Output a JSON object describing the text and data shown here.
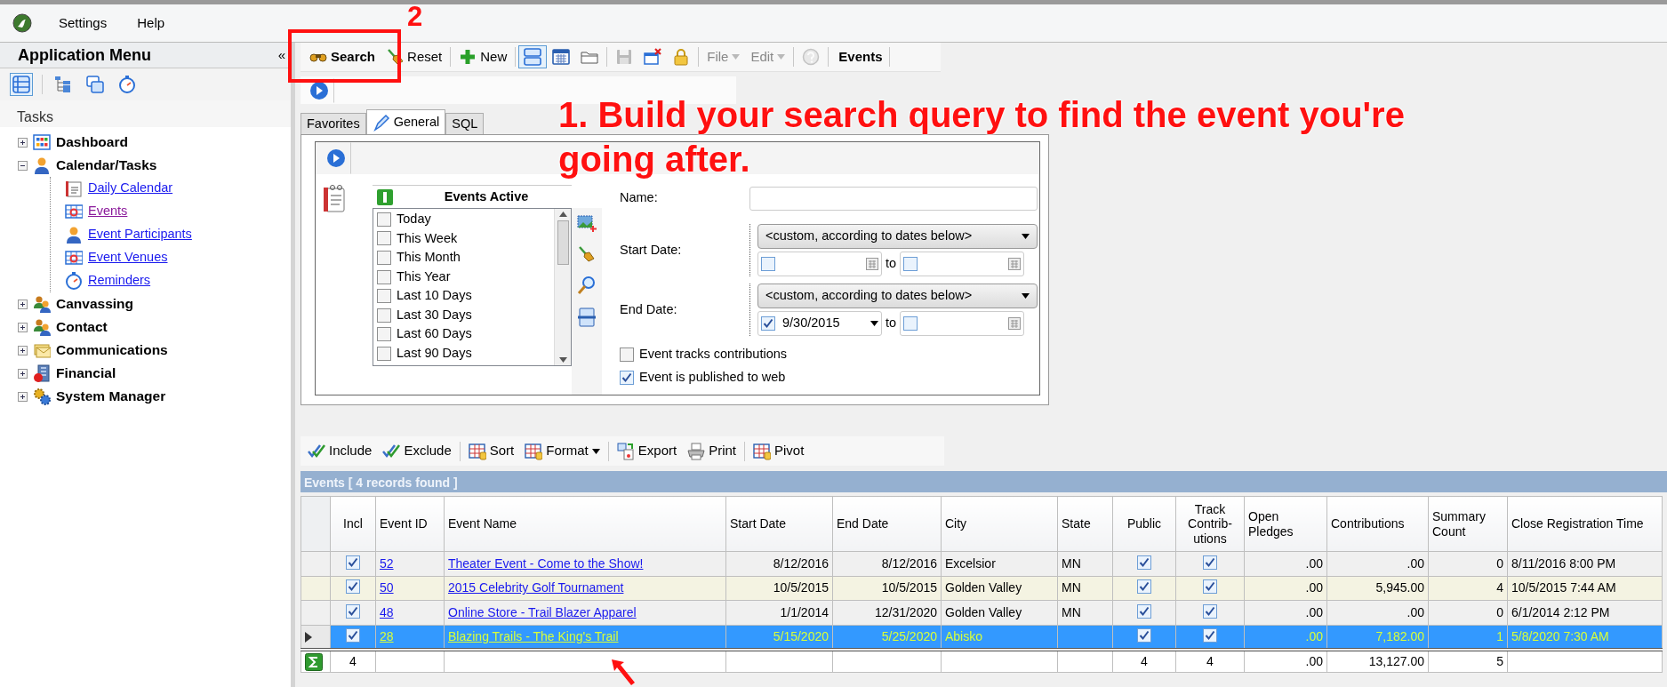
{
  "menu_bar": {
    "items": [
      "Settings",
      "Help"
    ]
  },
  "sidebar": {
    "title": "Application Menu",
    "collapse": "«",
    "views": [
      {
        "selected": true
      },
      {
        "selected": false
      },
      {
        "selected": false
      },
      {
        "selected": false
      }
    ],
    "section": "Tasks",
    "tree": [
      {
        "label": "Dashboard",
        "expanded": false
      },
      {
        "label": "Calendar/Tasks",
        "expanded": true,
        "children": [
          {
            "label": "Daily Calendar",
            "visited": false
          },
          {
            "label": "Events",
            "visited": true
          },
          {
            "label": "Event Participants",
            "visited": false
          },
          {
            "label": "Event Venues",
            "visited": false
          },
          {
            "label": "Reminders",
            "visited": false
          }
        ]
      },
      {
        "label": "Canvassing",
        "expanded": false
      },
      {
        "label": "Contact",
        "expanded": false
      },
      {
        "label": "Communications",
        "expanded": false
      },
      {
        "label": "Financial",
        "expanded": false
      },
      {
        "label": "System Manager",
        "expanded": false
      }
    ]
  },
  "toolbar": {
    "items": [
      {
        "kind": "button",
        "label": "Search",
        "bold": true,
        "disabled": false
      },
      {
        "kind": "button",
        "label": "Reset",
        "bold": false,
        "disabled": false
      },
      {
        "kind": "separator"
      },
      {
        "kind": "button",
        "label": "New",
        "bold": false,
        "disabled": false
      },
      {
        "kind": "separator"
      },
      {
        "kind": "toggle",
        "selected": true
      },
      {
        "kind": "toggle",
        "selected": false
      },
      {
        "kind": "toggle",
        "selected": false
      },
      {
        "kind": "separator"
      },
      {
        "kind": "icon_button",
        "disabled": true
      },
      {
        "kind": "icon_button",
        "disabled": false
      },
      {
        "kind": "icon_button",
        "disabled": false
      },
      {
        "kind": "separator"
      },
      {
        "kind": "menu",
        "label": "File",
        "disabled": true
      },
      {
        "kind": "menu",
        "label": "Edit",
        "disabled": true
      },
      {
        "kind": "separator"
      },
      {
        "kind": "icon_button",
        "disabled": true
      },
      {
        "kind": "separator"
      },
      {
        "kind": "title",
        "label": "Events"
      }
    ]
  },
  "search_panel": {
    "tabs": [
      {
        "label": "Favorites",
        "selected": false
      },
      {
        "label": "General",
        "selected": true
      },
      {
        "label": "SQL",
        "selected": false
      }
    ],
    "list_title": "Events Active",
    "options": [
      {
        "label": "Today",
        "checked": false
      },
      {
        "label": "This Week",
        "checked": false
      },
      {
        "label": "This Month",
        "checked": false
      },
      {
        "label": "This Year",
        "checked": false
      },
      {
        "label": "Last 10 Days",
        "checked": false
      },
      {
        "label": "Last 30 Days",
        "checked": false
      },
      {
        "label": "Last 60 Days",
        "checked": false
      },
      {
        "label": "Last 90 Days",
        "checked": false
      }
    ],
    "name": {
      "label": "Name:"
    },
    "date_ranges": [
      {
        "label": "Start Date:",
        "preset": "<custom, according to dates below>",
        "from": {
          "checked": false
        },
        "to_label": "to",
        "to": {
          "checked": false
        }
      },
      {
        "label": "End Date:",
        "preset": "<custom, according to dates below>",
        "from": {
          "checked": true,
          "value": "9/30/2015"
        },
        "to_label": "to",
        "to": {
          "checked": false
        }
      }
    ],
    "checkboxes": [
      {
        "label": "Event tracks contributions",
        "checked": false
      },
      {
        "label": "Event is published to web",
        "checked": true
      }
    ]
  },
  "results_toolbar": {
    "items": [
      {
        "kind": "button",
        "label": "Include"
      },
      {
        "kind": "button",
        "label": "Exclude"
      },
      {
        "kind": "separator"
      },
      {
        "kind": "button",
        "label": "Sort"
      },
      {
        "kind": "menu",
        "label": "Format"
      },
      {
        "kind": "separator"
      },
      {
        "kind": "button",
        "label": "Export"
      },
      {
        "kind": "button",
        "label": "Print"
      },
      {
        "kind": "separator"
      },
      {
        "kind": "button",
        "label": "Pivot"
      }
    ]
  },
  "grid": {
    "title": "Events [ 4 records found ]",
    "columns": [
      {
        "label": "Incl",
        "kind": "check",
        "total": "4"
      },
      {
        "label": "Event ID",
        "kind": "link"
      },
      {
        "label": "Event Name",
        "kind": "link"
      },
      {
        "label": "Start Date",
        "kind": "number"
      },
      {
        "label": "End Date",
        "kind": "number"
      },
      {
        "label": "City",
        "kind": "text"
      },
      {
        "label": "State",
        "kind": "text"
      },
      {
        "label": "Public",
        "kind": "check",
        "total": "4"
      },
      {
        "label": "Track Contrib-utions",
        "kind": "check",
        "total": "4"
      },
      {
        "label": "Open Pledges",
        "kind": "number",
        "total": ".00"
      },
      {
        "label": "Contributions",
        "kind": "number",
        "total": "13,127.00"
      },
      {
        "label": "Summary Count",
        "kind": "number",
        "total": "5"
      },
      {
        "label": "Close Registration Time",
        "kind": "text"
      }
    ],
    "rows": [
      {
        "selected": false,
        "incl": {
          "checked": true
        },
        "event_id": "52",
        "event_name": "Theater Event - Come to the Show!",
        "start_date": "8/12/2016",
        "end_date": "8/12/2016",
        "city": "Excelsior",
        "state": "MN",
        "public": {
          "checked": true
        },
        "track_contributions": {
          "checked": true
        },
        "open_pledges": ".00",
        "contributions": ".00",
        "summary_count": "0",
        "close_registration_time": "8/11/2016 8:00 PM"
      },
      {
        "selected": false,
        "incl": {
          "checked": true
        },
        "event_id": "50",
        "event_name": "2015 Celebrity Golf Tournament",
        "start_date": "10/5/2015",
        "end_date": "10/5/2015",
        "city": "Golden Valley",
        "state": "MN",
        "public": {
          "checked": true
        },
        "track_contributions": {
          "checked": true
        },
        "open_pledges": ".00",
        "contributions": "5,945.00",
        "summary_count": "4",
        "close_registration_time": "10/5/2015 7:44 AM"
      },
      {
        "selected": false,
        "incl": {
          "checked": true
        },
        "event_id": "48",
        "event_name": "Online Store - Trail Blazer Apparel",
        "start_date": "1/1/2014",
        "end_date": "12/31/2020",
        "city": "Golden Valley",
        "state": "MN",
        "public": {
          "checked": true
        },
        "track_contributions": {
          "checked": true
        },
        "open_pledges": ".00",
        "contributions": ".00",
        "summary_count": "0",
        "close_registration_time": "6/1/2014 2:12 PM"
      },
      {
        "selected": true,
        "incl": {
          "checked": true
        },
        "event_id": "28",
        "event_name": "Blazing Trails - The King's Trail",
        "start_date": "5/15/2020",
        "end_date": "5/25/2020",
        "city": "Abisko",
        "public": {
          "checked": true
        },
        "track_contributions": {
          "checked": true
        },
        "open_pledges": ".00",
        "contributions": "7,182.00",
        "summary_count": "1",
        "close_registration_time": "5/8/2020 7:30 AM"
      }
    ]
  },
  "annotations": [
    {
      "kind": "number",
      "text": "2"
    },
    {
      "kind": "frame"
    },
    {
      "kind": "callout",
      "text": "1. Build your search query to find the event you're going after."
    },
    {
      "kind": "arrow"
    }
  ]
}
